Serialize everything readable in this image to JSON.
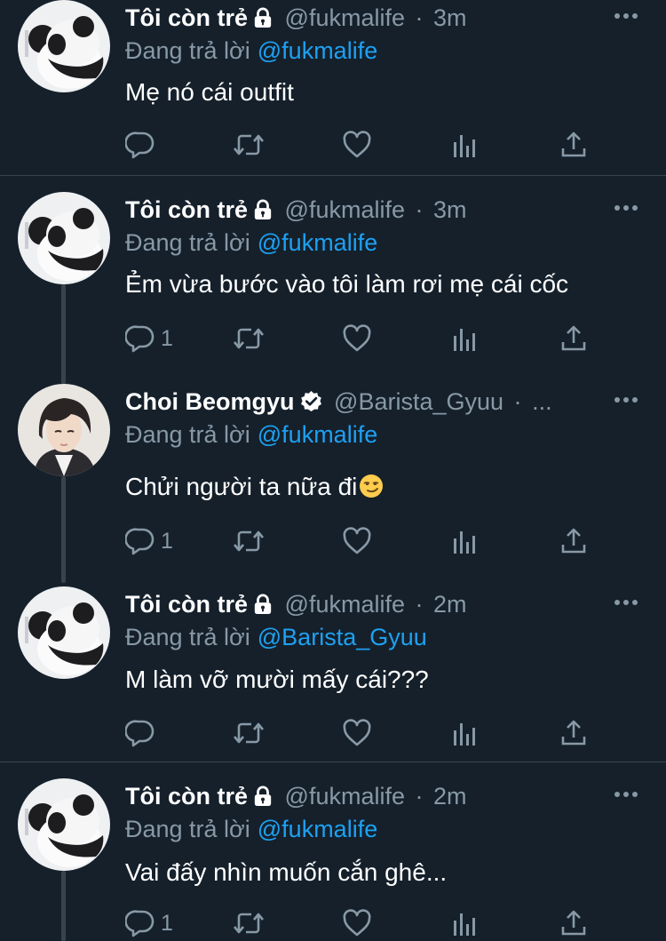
{
  "colors": {
    "background": "#15202b",
    "primary_text": "#ffffff",
    "secondary_text": "#8899a6",
    "link": "#1da1f2",
    "divider": "#38444d"
  },
  "tweets": [
    {
      "author": {
        "name": "Tôi còn trẻ",
        "handle": "@fukmalife",
        "badge": "lock-icon"
      },
      "time": "3m",
      "replying_prefix": "Đang trả lời",
      "replying_to": "@fukmalife",
      "text": "Mẹ nó cái outfit",
      "reply_count": ""
    },
    {
      "author": {
        "name": "Tôi còn trẻ",
        "handle": "@fukmalife",
        "badge": "lock-icon"
      },
      "time": "3m",
      "replying_prefix": "Đang trả lời",
      "replying_to": "@fukmalife",
      "text": "Ẻm vừa bước vào tôi làm rơi mẹ cái cốc",
      "reply_count": "1"
    },
    {
      "author": {
        "name": "Choi Beomgyu",
        "handle": "@Barista_Gyuu",
        "badge": "verified-icon"
      },
      "time": "...",
      "replying_prefix": "Đang trả lời",
      "replying_to": "@fukmalife",
      "text": "Chửi người ta nữa đi",
      "emoji": "smirk-emoji-icon",
      "reply_count": "1"
    },
    {
      "author": {
        "name": "Tôi còn trẻ",
        "handle": "@fukmalife",
        "badge": "lock-icon"
      },
      "time": "2m",
      "replying_prefix": "Đang trả lời",
      "replying_to": "@Barista_Gyuu",
      "text": "M làm vỡ mười mấy cái???",
      "reply_count": ""
    },
    {
      "author": {
        "name": "Tôi còn trẻ",
        "handle": "@fukmalife",
        "badge": "lock-icon"
      },
      "time": "2m",
      "replying_prefix": "Đang trả lời",
      "replying_to": "@fukmalife",
      "text": "Vai đấy nhìn muốn cắn ghê...",
      "reply_count": "1"
    }
  ],
  "action_icons": [
    "reply-icon",
    "retweet-icon",
    "like-icon",
    "analytics-icon",
    "share-icon"
  ],
  "separator": "·"
}
